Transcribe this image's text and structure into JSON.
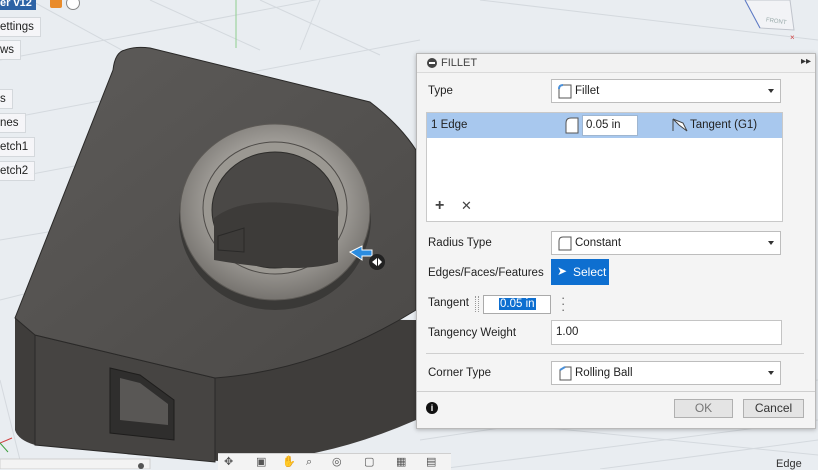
{
  "browser": {
    "doc_title": "er v12",
    "items": [
      "ettings",
      "ws",
      "s",
      "nes",
      "etch1",
      "etch2"
    ]
  },
  "viewcube": {
    "face_label": "FRONT"
  },
  "dialog": {
    "title": "FILLET",
    "type_label": "Type",
    "type_value": "Fillet",
    "edge_row": {
      "selection": "1 Edge",
      "radius": "0.05 in",
      "continuity": "Tangent (G1)"
    },
    "radius_type_label": "Radius Type",
    "radius_type_value": "Constant",
    "edges_label": "Edges/Faces/Features",
    "select_label": "Select",
    "tangent_label": "Tangent",
    "tangent_value": "0.05 in",
    "tangency_weight_label": "Tangency Weight",
    "tangency_weight_value": "1.00",
    "corner_type_label": "Corner Type",
    "corner_type_value": "Rolling Ball",
    "ok_label": "OK",
    "cancel_label": "Cancel"
  },
  "status": {
    "bottom_right": "Edge"
  },
  "colors": {
    "accent": "#0e6fd0",
    "selection_row": "#a8c8ee",
    "model_gray": "#4a4846",
    "doc_tab": "#2d63a5"
  }
}
